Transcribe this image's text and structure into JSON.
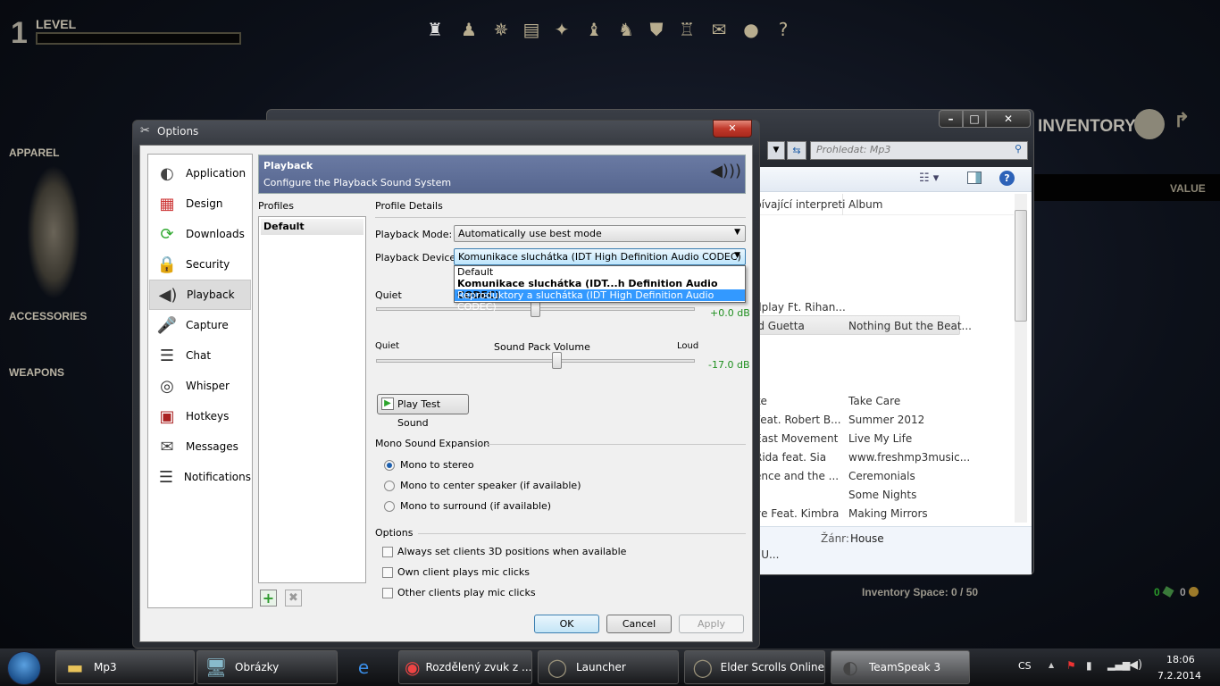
{
  "game": {
    "level_number": "1",
    "level_label": "LEVEL",
    "top_icons": [
      "bag-icon",
      "character-icon",
      "skills-icon",
      "journal-icon",
      "map-icon",
      "alliance-icon",
      "group-icon",
      "guild-icon",
      "campaign-icon",
      "mail-icon",
      "chat-icon",
      "help-icon"
    ],
    "help_glyph": "?",
    "apparel": "APPAREL",
    "accessories": "ACCESSORIES",
    "weapons": "WEAPONS",
    "inventory_title": "INVENTORY",
    "value_header": "VALUE",
    "inventory_space": "Inventory Space: 0 / 50",
    "currency_1": "0",
    "currency_2": "0"
  },
  "explorer": {
    "search_placeholder": "Prohledat: Mp3",
    "columns": [
      "pívající interpreti",
      "Album"
    ],
    "rows": [
      {
        "artist": "dplay Ft. Rihan...",
        "album": ""
      },
      {
        "artist": "id Guetta",
        "album": "Nothing But the Beat...",
        "selected": true
      },
      {
        "artist": "ke",
        "album": "Take Care"
      },
      {
        "artist": "Feat. Robert B...",
        "album": "Summer 2012"
      },
      {
        "artist": "East Movement",
        "album": "Live My Life"
      },
      {
        "artist": "Rida feat. Sia",
        "album": "www.freshmp3music..."
      },
      {
        "artist": "ence and the ...",
        "album": "Ceremonials"
      },
      {
        "artist": "",
        "album": "Some Nights"
      },
      {
        "artist": "ye  Feat. Kimbra",
        "album": "Making Mirrors"
      }
    ],
    "details_genre_label": "Žánr:",
    "details_genre_value": "House",
    "details_extra": "t (U..."
  },
  "dialog": {
    "title": "Options",
    "sidebar": [
      {
        "label": "Application",
        "icon": "teamspeak-icon"
      },
      {
        "label": "Design",
        "icon": "design-icon"
      },
      {
        "label": "Downloads",
        "icon": "downloads-icon"
      },
      {
        "label": "Security",
        "icon": "security-icon"
      },
      {
        "label": "Playback",
        "icon": "speaker-icon",
        "selected": true
      },
      {
        "label": "Capture",
        "icon": "microphone-icon"
      },
      {
        "label": "Chat",
        "icon": "chat-icon"
      },
      {
        "label": "Whisper",
        "icon": "headset-icon"
      },
      {
        "label": "Hotkeys",
        "icon": "hotkeys-icon"
      },
      {
        "label": "Messages",
        "icon": "messages-icon"
      },
      {
        "label": "Notifications",
        "icon": "notifications-icon"
      }
    ],
    "header_title": "Playback",
    "header_subtitle": "Configure the Playback Sound System",
    "profiles_label": "Profiles",
    "profiles": [
      "Default"
    ],
    "details_label": "Profile Details",
    "mode_label": "Playback Mode:",
    "mode_value": "Automatically use best mode",
    "device_label": "Playback Device:",
    "device_value": "Komunikace sluchátka (IDT High Definition Audio CODEC)",
    "device_options": [
      "Default",
      "Komunikace sluchátka (IDT...h Definition Audio CODEC)",
      "Reproduktory a sluchátka (IDT High Definition Audio CODEC)"
    ],
    "volume_quiet": "Quiet",
    "volume_db": "+0.0 dB",
    "volume_fraction": 0.5,
    "pack_quiet": "Quiet",
    "pack_title": "Sound Pack Volume",
    "pack_loud": "Loud",
    "pack_db": "-17.0 dB",
    "pack_fraction": 0.57,
    "play_test": "Play Test Sound",
    "mono_group": "Mono Sound Expansion",
    "mono_options": [
      "Mono to stereo",
      "Mono to center speaker (if available)",
      "Mono to surround (if available)"
    ],
    "mono_selected": 0,
    "options_group": "Options",
    "checkboxes": [
      "Always set clients 3D positions when available",
      "Own client plays mic clicks",
      "Other clients play mic clicks"
    ],
    "ok": "OK",
    "cancel": "Cancel",
    "apply": "Apply",
    "accent": "#3399ff",
    "header_color": "#5d6c95",
    "db_color": "#1f8f1f"
  },
  "taskbar": {
    "items": [
      {
        "label": "Mp3",
        "icon": "folder-icon"
      },
      {
        "label": "Obrázky",
        "icon": "computer-icon"
      },
      {
        "label": "",
        "icon": "ie-icon"
      },
      {
        "label": "Rozdělený zvuk z ...",
        "icon": "chrome-icon"
      },
      {
        "label": "Launcher",
        "icon": "eso-icon"
      },
      {
        "label": "Elder Scrolls Online",
        "icon": "eso-icon"
      },
      {
        "label": "TeamSpeak 3",
        "icon": "teamspeak-icon"
      }
    ],
    "language": "CS",
    "time": "18:06",
    "date": "7.2.2014"
  }
}
